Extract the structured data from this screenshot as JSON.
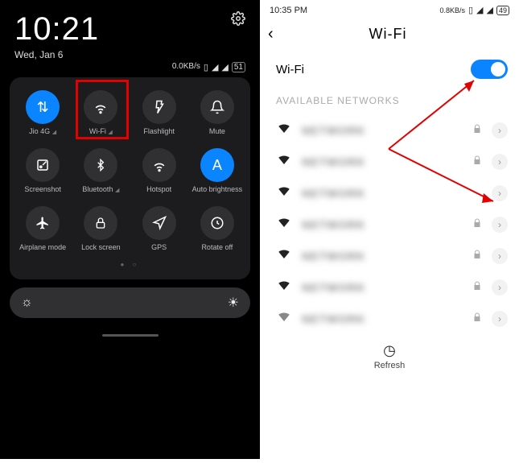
{
  "left": {
    "clock": "10:21",
    "date": "Wed, Jan 6",
    "data_rate": "0.0KB/s",
    "battery": "51",
    "tiles": [
      {
        "label": "Jio 4G",
        "icon": "⇅",
        "active": true
      },
      {
        "label": "Wi-Fi",
        "icon": "wifi",
        "active": false
      },
      {
        "label": "Flashlight",
        "icon": "flash",
        "active": false
      },
      {
        "label": "Mute",
        "icon": "bell",
        "active": false
      },
      {
        "label": "Screenshot",
        "icon": "scissors",
        "active": false
      },
      {
        "label": "Bluetooth",
        "icon": "bt",
        "active": false
      },
      {
        "label": "Hotspot",
        "icon": "wifi",
        "active": false
      },
      {
        "label": "Auto brightness",
        "icon": "A",
        "active": true
      },
      {
        "label": "Airplane mode",
        "icon": "plane",
        "active": false
      },
      {
        "label": "Lock screen",
        "icon": "lock",
        "active": false
      },
      {
        "label": "GPS",
        "icon": "nav",
        "active": false
      },
      {
        "label": "Rotate off",
        "icon": "rotate",
        "active": false
      }
    ]
  },
  "right": {
    "time": "10:35 PM",
    "data_rate": "0.8KB/s",
    "battery": "49",
    "title": "Wi-Fi",
    "toggle_label": "Wi-Fi",
    "section": "AVAILABLE NETWORKS",
    "networks": [
      {
        "locked": true,
        "strength": "full"
      },
      {
        "locked": true,
        "strength": "full"
      },
      {
        "locked": false,
        "strength": "full"
      },
      {
        "locked": true,
        "strength": "mid"
      },
      {
        "locked": true,
        "strength": "mid"
      },
      {
        "locked": true,
        "strength": "mid"
      },
      {
        "locked": true,
        "strength": "low"
      }
    ],
    "refresh": "Refresh"
  }
}
